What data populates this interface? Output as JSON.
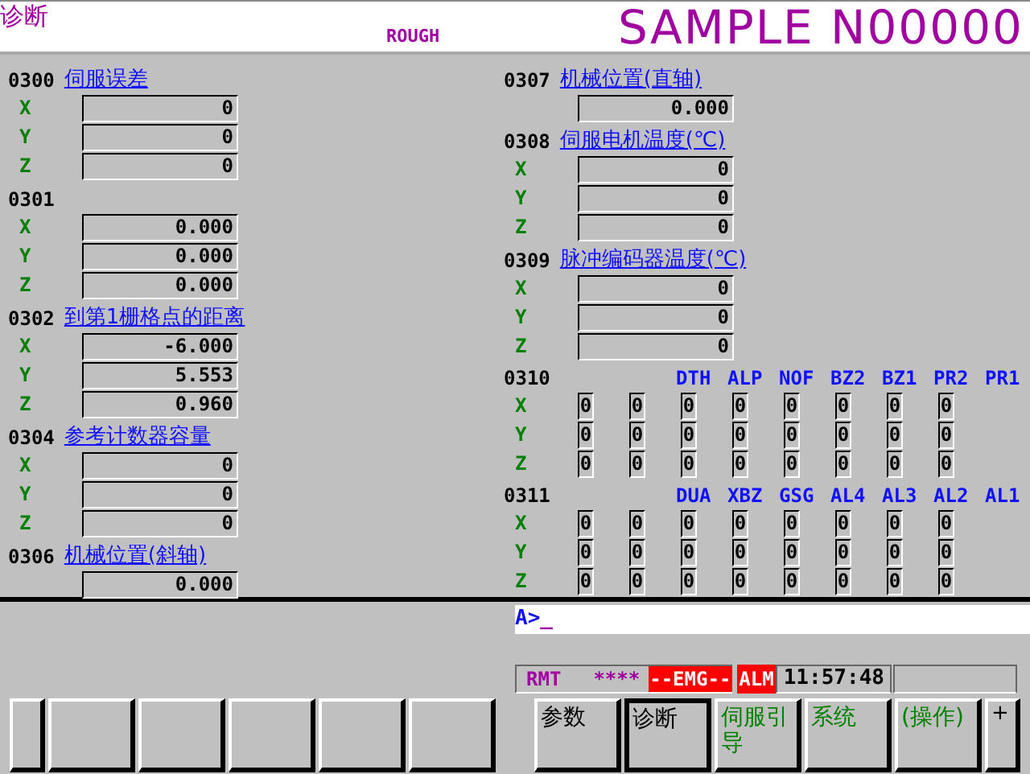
{
  "header": {
    "title": "诊断",
    "mode": "ROUGH",
    "program": "SAMPLE N00000"
  },
  "columns": [
    [
      {
        "kind": "axes",
        "number": "0300",
        "title": "伺服误差",
        "rows": [
          {
            "axis": "X",
            "value": "0"
          },
          {
            "axis": "Y",
            "value": "0"
          },
          {
            "axis": "Z",
            "value": "0"
          }
        ]
      },
      {
        "kind": "axes",
        "number": "0301",
        "rows": [
          {
            "axis": "X",
            "value": "0.000"
          },
          {
            "axis": "Y",
            "value": "0.000"
          },
          {
            "axis": "Z",
            "value": "0.000"
          }
        ]
      },
      {
        "kind": "axes",
        "number": "0302",
        "title": "到第1栅格点的距离",
        "rows": [
          {
            "axis": "X",
            "value": "-6.000"
          },
          {
            "axis": "Y",
            "value": "5.553"
          },
          {
            "axis": "Z",
            "value": "0.960"
          }
        ]
      },
      {
        "kind": "axes",
        "number": "0304",
        "title": "参考计数器容量",
        "rows": [
          {
            "axis": "X",
            "value": "0"
          },
          {
            "axis": "Y",
            "value": "0"
          },
          {
            "axis": "Z",
            "value": "0"
          }
        ]
      },
      {
        "kind": "axes",
        "number": "0306",
        "title": "机械位置(斜轴)",
        "rows": [
          {
            "value": "0.000"
          }
        ]
      }
    ],
    [
      {
        "kind": "axes",
        "number": "0307",
        "title": "机械位置(直轴)",
        "rows": [
          {
            "value": "0.000"
          }
        ]
      },
      {
        "kind": "axes",
        "number": "0308",
        "title": "伺服电机温度(℃)",
        "rows": [
          {
            "axis": "X",
            "value": "0"
          },
          {
            "axis": "Y",
            "value": "0"
          },
          {
            "axis": "Z",
            "value": "0"
          }
        ]
      },
      {
        "kind": "axes",
        "number": "0309",
        "title": "脉冲编码器温度(℃)",
        "rows": [
          {
            "axis": "X",
            "value": "0"
          },
          {
            "axis": "Y",
            "value": "0"
          },
          {
            "axis": "Z",
            "value": "0"
          }
        ]
      },
      {
        "kind": "bits",
        "number": "0310",
        "bits": [
          "DTH",
          "ALP",
          "NOF",
          "BZ2",
          "BZ1",
          "PR2",
          "PR1"
        ],
        "rows": [
          {
            "axis": "X",
            "values": [
              "0",
              "0",
              "0",
              "0",
              "0",
              "0",
              "0",
              "0"
            ]
          },
          {
            "axis": "Y",
            "values": [
              "0",
              "0",
              "0",
              "0",
              "0",
              "0",
              "0",
              "0"
            ]
          },
          {
            "axis": "Z",
            "values": [
              "0",
              "0",
              "0",
              "0",
              "0",
              "0",
              "0",
              "0"
            ]
          }
        ]
      },
      {
        "kind": "bits",
        "number": "0311",
        "bits": [
          "DUA",
          "XBZ",
          "GSG",
          "AL4",
          "AL3",
          "AL2",
          "AL1"
        ],
        "rows": [
          {
            "axis": "X",
            "values": [
              "0",
              "0",
              "0",
              "0",
              "0",
              "0",
              "0",
              "0"
            ]
          },
          {
            "axis": "Y",
            "values": [
              "0",
              "0",
              "0",
              "0",
              "0",
              "0",
              "0",
              "0"
            ]
          },
          {
            "axis": "Z",
            "values": [
              "0",
              "0",
              "0",
              "0",
              "0",
              "0",
              "0",
              "0"
            ]
          }
        ]
      }
    ]
  ],
  "input": {
    "prompt": "A>",
    "cursor": "_"
  },
  "status": {
    "mode": "RMT",
    "stars": "****",
    "emergency": "--EMG--",
    "alarm": "ALM",
    "time": "11:57:48"
  },
  "softkeys": [
    {
      "kind": "key",
      "label": "参数",
      "selected": false
    },
    {
      "kind": "key",
      "label": "诊断",
      "selected": true
    },
    {
      "kind": "key",
      "label": "伺服引导",
      "selected": false
    },
    {
      "kind": "key",
      "label": "系统",
      "selected": false
    },
    {
      "kind": "key",
      "label": "(操作)",
      "selected": false
    },
    {
      "kind": "next",
      "label": "+",
      "selected": false
    }
  ]
}
